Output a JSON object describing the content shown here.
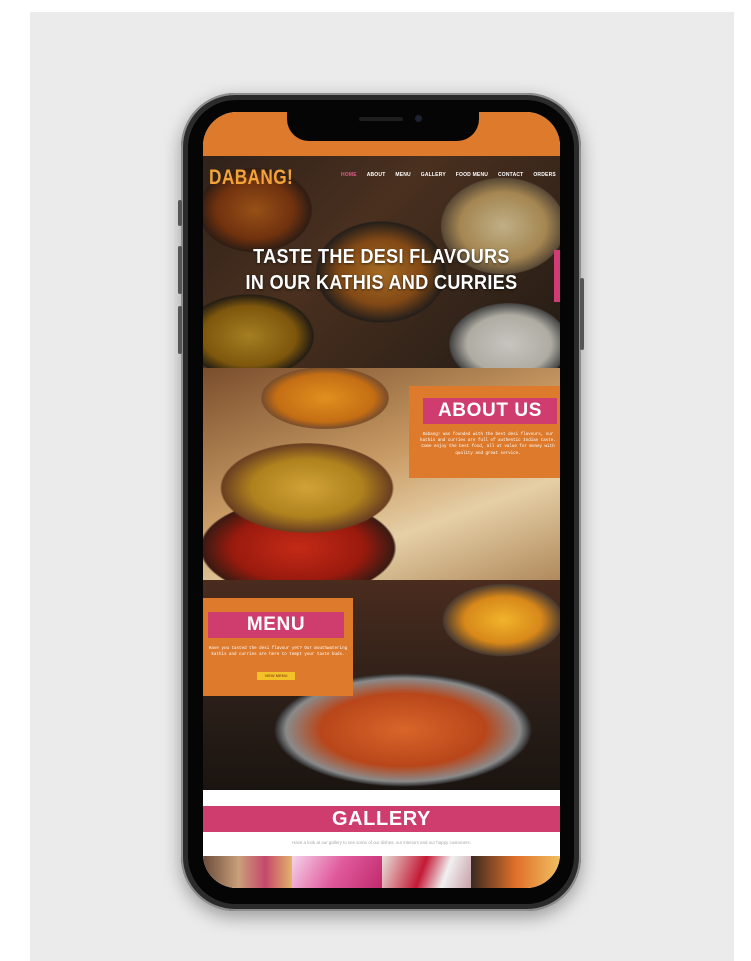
{
  "site": {
    "logo": "DABANG!",
    "nav": [
      "HOME",
      "ABOUT",
      "MENU",
      "GALLERY",
      "FOOD MENU",
      "CONTACT",
      "ORDERS"
    ],
    "active_nav_index": 0
  },
  "hero": {
    "line1": "TASTE THE DESI FLAVOURS",
    "line2": "IN OUR KATHIS AND CURRIES"
  },
  "about": {
    "title": "ABOUT US",
    "text": "Dabang! was founded with the best desi flavours, our kathis and curries are full of authentic Indian taste. Come enjoy the best food, all at value for money with quality and great service."
  },
  "menu": {
    "title": "MENU",
    "text": "Have you tasted the desi flavour yet? Our mouthwatering kathis and curries are here to tempt your taste buds.",
    "button": "VIEW MENU"
  },
  "gallery": {
    "title": "GALLERY",
    "text": "Have a look at our gallery to see some of our dishes, our interiors and our happy customers."
  },
  "colors": {
    "orange": "#dd7a2c",
    "pink": "#cf3c6e",
    "yellow": "#f2c228",
    "device": "#2b2b2b"
  }
}
